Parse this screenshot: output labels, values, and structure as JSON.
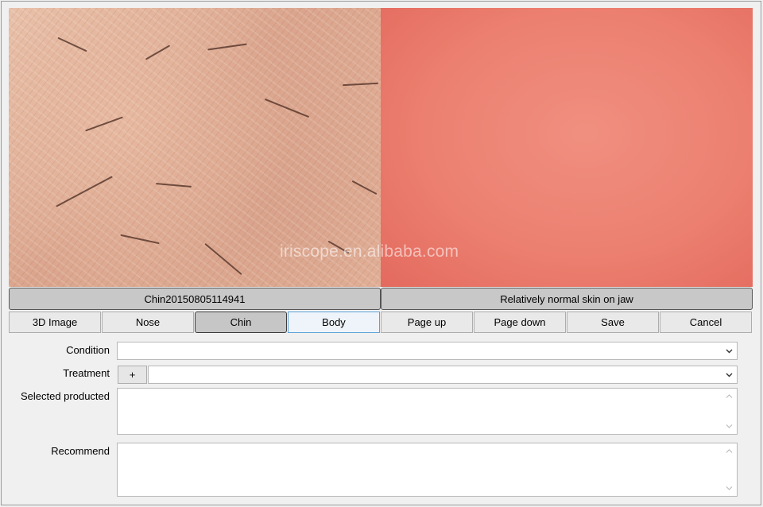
{
  "images": {
    "watermark": "iriscope.en.alibaba.com"
  },
  "captions": {
    "left": "Chin20150805114941",
    "right": "Relatively normal skin on jaw"
  },
  "buttons": [
    {
      "label": "3D Image"
    },
    {
      "label": "Nose"
    },
    {
      "label": "Chin"
    },
    {
      "label": "Body"
    },
    {
      "label": "Page up"
    },
    {
      "label": "Page down"
    },
    {
      "label": "Save"
    },
    {
      "label": "Cancel"
    }
  ],
  "form": {
    "condition_label": "Condition",
    "condition_value": "",
    "treatment_label": "Treatment",
    "treatment_add": "+",
    "treatment_value": "",
    "selected_label": "Selected producted",
    "selected_value": "",
    "recommend_label": "Recommend",
    "recommend_value": ""
  },
  "icons": {
    "dropdown": "chevron-down-icon",
    "scroll_up": "scroll-up-arrow-icon",
    "scroll_down": "scroll-down-arrow-icon"
  }
}
